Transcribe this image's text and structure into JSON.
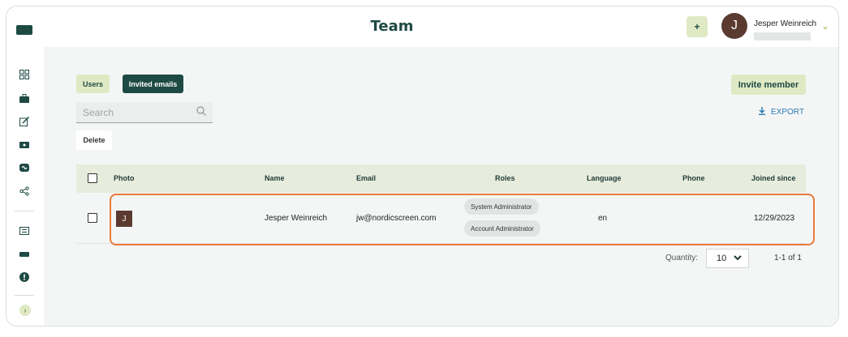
{
  "header": {
    "title": "Team",
    "add_label": "+",
    "user_initial": "J",
    "user_name": "Jesper Weinreich"
  },
  "sidebar": {
    "items": [
      {
        "icon": "dashboard-icon",
        "glyph": "⊞"
      },
      {
        "icon": "briefcase-icon",
        "glyph": "▣"
      },
      {
        "icon": "edit-icon",
        "glyph": "✎"
      },
      {
        "icon": "screen-icon",
        "glyph": "▬"
      },
      {
        "icon": "loop-icon",
        "glyph": "∞"
      },
      {
        "icon": "share-icon",
        "glyph": "<"
      },
      {
        "icon": "list-icon",
        "glyph": "☰"
      },
      {
        "icon": "bar-icon",
        "glyph": "▬"
      },
      {
        "icon": "alert-icon",
        "glyph": "!"
      }
    ],
    "expand_label": "›"
  },
  "tabs": {
    "users": "Users",
    "invited": "Invited emails"
  },
  "actions": {
    "invite_label": "Invite member",
    "export_label": "EXPORT",
    "delete_label": "Delete"
  },
  "search": {
    "placeholder": "Search"
  },
  "table": {
    "headers": {
      "photo": "Photo",
      "name": "Name",
      "email": "Email",
      "roles": "Roles",
      "language": "Language",
      "phone": "Phone",
      "joined": "Joined since"
    },
    "rows": [
      {
        "initial": "J",
        "name": "Jesper Weinreich",
        "email": "jw@nordicscreen.com",
        "roles": [
          "System Administrator",
          "Account Administrator"
        ],
        "language": "en",
        "phone": "",
        "joined": "12/29/2023"
      }
    ]
  },
  "footer": {
    "quantity_label": "Quantity:",
    "quantity_value": "10",
    "pagination": "1-1 of 1"
  },
  "colors": {
    "brand": "#1e4a44",
    "accent_light": "#dfe9c4",
    "highlight": "#ea7a3c",
    "link": "#2d7bb4"
  }
}
